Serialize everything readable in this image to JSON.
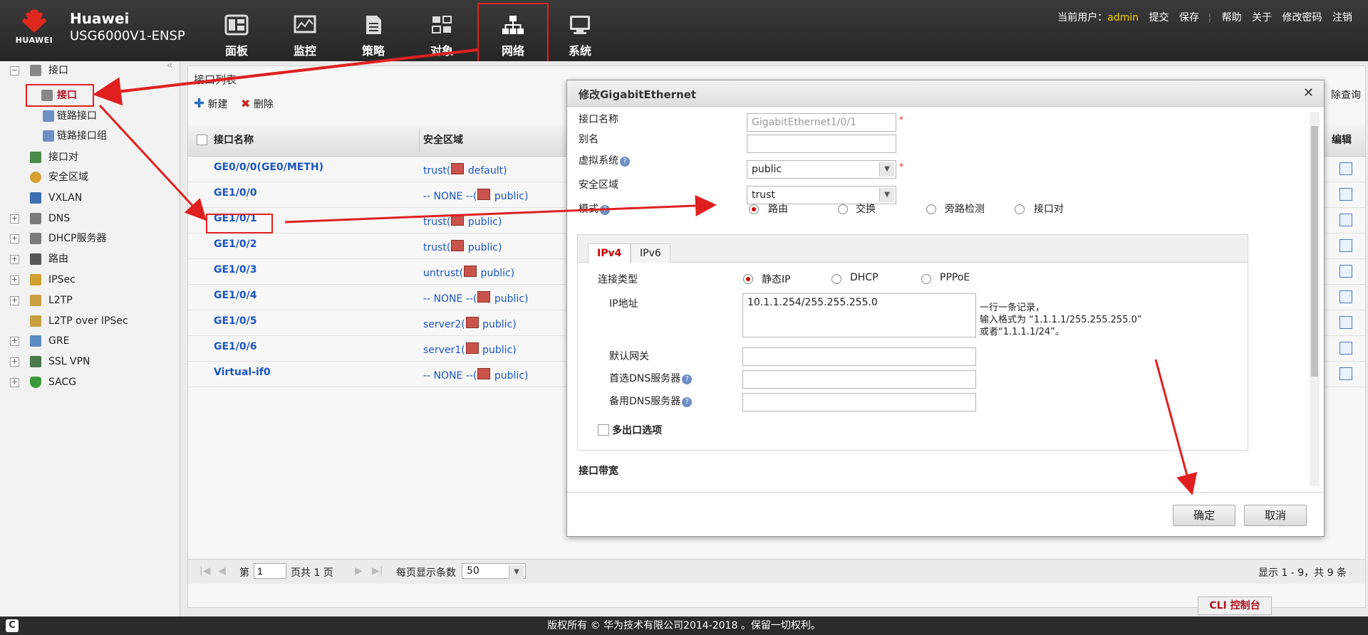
{
  "header": {
    "brand": "HUAWEI",
    "product_line1": "Huawei",
    "product_line2": "USG6000V1-ENSP",
    "nav": [
      {
        "label": "面板",
        "icon": "dashboard-icon"
      },
      {
        "label": "监控",
        "icon": "monitor-icon"
      },
      {
        "label": "策略",
        "icon": "policy-icon"
      },
      {
        "label": "对象",
        "icon": "object-icon"
      },
      {
        "label": "网络",
        "icon": "network-icon"
      },
      {
        "label": "系统",
        "icon": "system-icon"
      }
    ],
    "current_user_label": "当前用户：",
    "current_user": "admin",
    "links": [
      "提交",
      "保存",
      "帮助",
      "关于",
      "修改密码",
      "注销"
    ]
  },
  "sidebar": {
    "items": [
      {
        "label": "接口",
        "expander": "−"
      },
      {
        "label": "接口"
      },
      {
        "label": "链路接口"
      },
      {
        "label": "链路接口组"
      },
      {
        "label": "接口对"
      },
      {
        "label": "安全区域"
      },
      {
        "label": "VXLAN"
      },
      {
        "label": "DNS",
        "expander": "+"
      },
      {
        "label": "DHCP服务器",
        "expander": "+"
      },
      {
        "label": "路由",
        "expander": "+"
      },
      {
        "label": "IPSec",
        "expander": "+"
      },
      {
        "label": "L2TP",
        "expander": "+"
      },
      {
        "label": "L2TP over IPSec"
      },
      {
        "label": "GRE",
        "expander": "+"
      },
      {
        "label": "SSL VPN",
        "expander": "+"
      },
      {
        "label": "SACG",
        "expander": "+"
      }
    ]
  },
  "panel": {
    "title": "接口列表",
    "toolbar": {
      "new": "新建",
      "delete": "删除",
      "query": "除查询"
    },
    "columns": {
      "name": "接口名称",
      "zone": "安全区域",
      "edit": "编辑"
    },
    "rows": [
      {
        "name": "GE0/0/0(GE0/METH)",
        "zone_pre": "trust(",
        "zone_post": " default)"
      },
      {
        "name": "GE1/0/0",
        "zone_pre": "-- NONE --(",
        "zone_post": " public)"
      },
      {
        "name": "GE1/0/1",
        "zone_pre": "trust(",
        "zone_post": " public)"
      },
      {
        "name": "GE1/0/2",
        "zone_pre": "trust(",
        "zone_post": " public)"
      },
      {
        "name": "GE1/0/3",
        "zone_pre": "untrust(",
        "zone_post": " public)"
      },
      {
        "name": "GE1/0/4",
        "zone_pre": "-- NONE --(",
        "zone_post": " public)"
      },
      {
        "name": "GE1/0/5",
        "zone_pre": "server2(",
        "zone_post": " public)"
      },
      {
        "name": "GE1/0/6",
        "zone_pre": "server1(",
        "zone_post": " public)"
      },
      {
        "name": "Virtual-if0",
        "zone_pre": "-- NONE --(",
        "zone_post": " public)"
      }
    ],
    "pager": {
      "page_label": "第",
      "page_value": "1",
      "total_label": "页共 1 页",
      "per_page_label": "每页显示条数",
      "per_page_value": "50",
      "summary": "显示 1 - 9，共 9 条"
    },
    "cli": "CLI 控制台"
  },
  "dialog": {
    "title": "修改GigabitEthernet",
    "labels": {
      "name": "接口名称",
      "alias": "别名",
      "vsys": "虚拟系统",
      "zone": "安全区域",
      "mode": "模式",
      "conn_type": "连接类型",
      "ip": "IP地址",
      "gateway": "默认网关",
      "dns1": "首选DNS服务器",
      "dns2": "备用DNS服务器",
      "multi_exit": "多出口选项",
      "bandwidth": "接口带宽"
    },
    "values": {
      "name": "GigabitEthernet1/0/1",
      "alias": "",
      "vsys": "public",
      "zone": "trust",
      "ip": "10.1.1.254/255.255.255.0"
    },
    "modes": [
      "路由",
      "交换",
      "旁路检测",
      "接口对"
    ],
    "tabs": [
      "IPv4",
      "IPv6"
    ],
    "conn_types": [
      "静态IP",
      "DHCP",
      "PPPoE"
    ],
    "ip_hint": [
      "一行一条记录，",
      "输入格式为 “1.1.1.1/255.255.255.0”",
      "或者“1.1.1.1/24”。"
    ],
    "ok": "确定",
    "cancel": "取消"
  },
  "footer": {
    "copyright": "版权所有 © 华为技术有限公司2014-2018 。保留一切权利。",
    "c_logo": "C"
  },
  "colors": {
    "accent_red": "#e02020",
    "link_blue": "#1a55c0",
    "user_yellow": "#f3d200"
  }
}
